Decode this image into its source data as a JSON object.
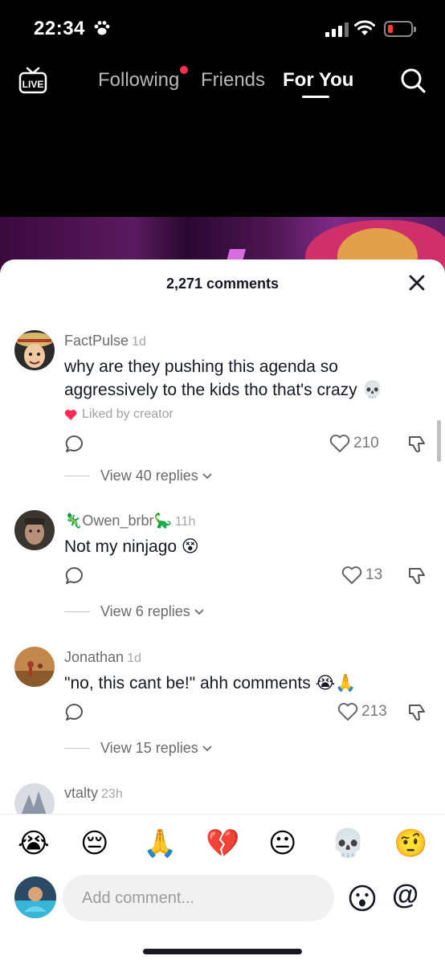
{
  "status_bar": {
    "time": "22:34",
    "battery_color": "#ff3b30"
  },
  "top_nav": {
    "live_label": "LIVE",
    "tabs": [
      {
        "label": "Following",
        "has_dot": true
      },
      {
        "label": "Friends"
      },
      {
        "label": "For You",
        "active": true
      }
    ],
    "dot_color": "#fe2c55"
  },
  "sheet": {
    "title": "2,271 comments",
    "comments": [
      {
        "user": "FactPulse",
        "time": "1d",
        "text": "why are they pushing this agenda so aggressively to the kids tho that's crazy 💀",
        "liked_by_creator": "Liked by creator",
        "likes": "210",
        "replies": "View 40 replies"
      },
      {
        "user": "🦎Owen_brbr🦕",
        "time": "11h",
        "text": "Not my ninjago 😵",
        "likes": "13",
        "replies": "View 6 replies"
      },
      {
        "user": "Jonathan",
        "time": "1d",
        "text": "\"no, this cant be!\" ahh comments 😭🙏",
        "likes": "213",
        "replies": "View 15 replies"
      },
      {
        "user": "vtalty",
        "time": "23h"
      }
    ]
  },
  "emoji_bar": [
    "😭",
    "😔",
    "🙏",
    "💔",
    "😐",
    "💀",
    "🤨"
  ],
  "input": {
    "placeholder": "Add comment...",
    "mention_symbol": "@"
  },
  "icons": {
    "like": "heart-outline-icon",
    "reply": "chat-bubble-icon",
    "dislike": "thumbs-down-icon",
    "close": "close-icon",
    "search": "search-icon"
  }
}
